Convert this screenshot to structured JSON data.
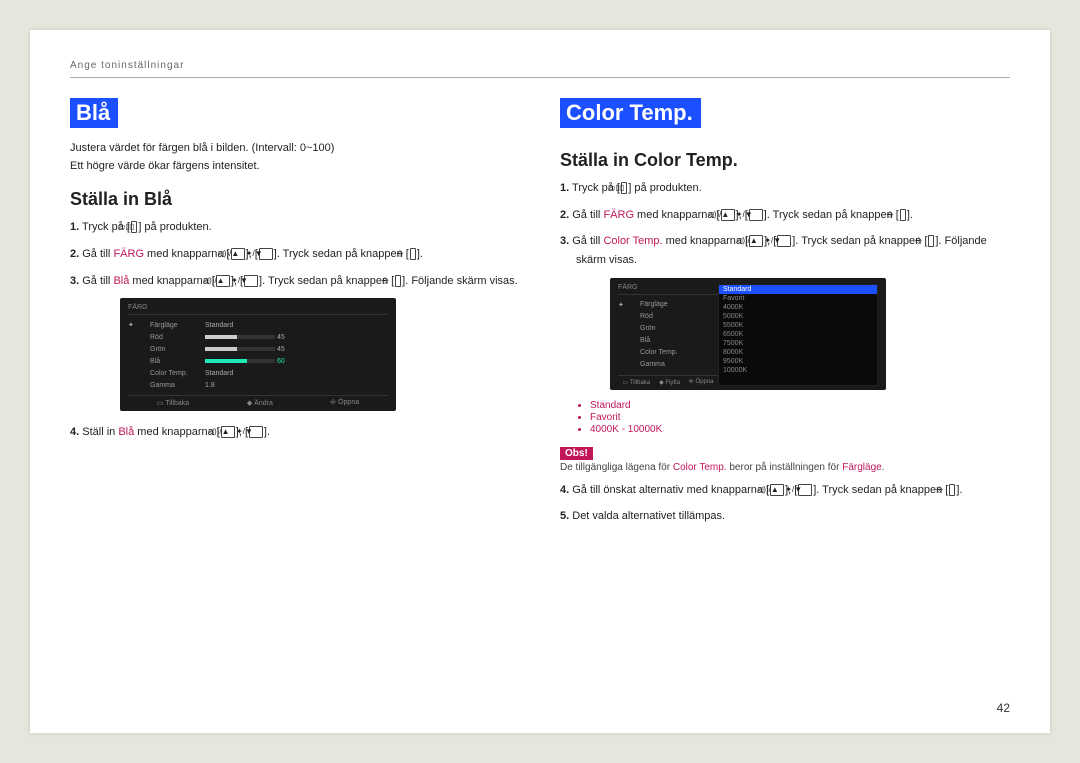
{
  "header": "Ange toninställningar",
  "left": {
    "title": "Blå",
    "intro1": "Justera värdet för färgen blå i bilden. (Intervall: 0~100)",
    "intro2": "Ett högre värde ökar färgens intensitet.",
    "subhead": "Ställa in Blå",
    "steps": {
      "s1a": "Tryck på [",
      "s1b": "] på produkten.",
      "s2a": "Gå till ",
      "s2accent": "FÄRG",
      "s2b": " med knapparna [",
      "s2c": "], [",
      "s2d": "]. Tryck sedan på knappen [",
      "s2e": "].",
      "s3a": "Gå till ",
      "s3accent": "Blå",
      "s3b": " med knapparna [",
      "s3c": "], [",
      "s3d": "]. Tryck sedan på knappen [",
      "s3e": "]. Följande skärm visas.",
      "s4a": "Ställ in ",
      "s4accent": "Blå",
      "s4b": " med knapparna [",
      "s4c": "], [",
      "s4d": "]."
    },
    "osd": {
      "title": "FÄRG",
      "rows": [
        {
          "label": "Färgläge",
          "value": "Standard"
        },
        {
          "label": "Röd",
          "fill": 45
        },
        {
          "label": "Grön",
          "fill": 45
        },
        {
          "label": "Blå",
          "fill": 60,
          "selected": true
        },
        {
          "label": "Color Temp.",
          "value": "Standard"
        },
        {
          "label": "Gamma",
          "value": "1.8"
        }
      ],
      "footer": [
        "Tillbaka",
        "Ändra",
        "Öppna"
      ]
    }
  },
  "right": {
    "title": "Color Temp.",
    "subhead": "Ställa in Color Temp.",
    "steps": {
      "s1a": "Tryck på [",
      "s1b": "] på produkten.",
      "s2a": "Gå till ",
      "s2accent": "FÄRG",
      "s2b": " med knapparna [",
      "s2c": "], [",
      "s2d": "]. Tryck sedan på knappen [",
      "s2e": "].",
      "s3a": "Gå till ",
      "s3accent": "Color Temp.",
      "s3b": " med knapparna [",
      "s3c": "], [",
      "s3d": "]. Tryck sedan på knappen [",
      "s3e": "]. Följande skärm visas.",
      "s4a": "Gå till önskat alternativ med knapparna [",
      "s4b": "], [",
      "s4c": "]. Tryck sedan på knappen [",
      "s4d": "].",
      "s5": "Det valda alternativet tillämpas."
    },
    "osd": {
      "title": "FÄRG",
      "side": [
        "Färgläge",
        "Röd",
        "Grön",
        "Blå",
        "Color Temp.",
        "Gamma"
      ],
      "list": [
        "Standard",
        "Favorit",
        "4000K",
        "5000K",
        "5500K",
        "6500K",
        "7500K",
        "8000K",
        "9500K",
        "10000K"
      ],
      "footer": [
        "Tillbaka",
        "Flytta",
        "Öppna"
      ]
    },
    "bullets": [
      "Standard",
      "Favorit",
      "4000K - 10000K"
    ],
    "note_label": "Obs!",
    "note_a": "De tillgängliga lägena för ",
    "note_accent1": "Color Temp.",
    "note_b": " beror på inställningen för ",
    "note_accent2": "Färgläge",
    "note_c": "."
  },
  "page_number": "42",
  "icons": {
    "menu": "▭▯▯",
    "updown": "◁))/▲",
    "leftright": "✦/▼",
    "enter": "⎆"
  }
}
